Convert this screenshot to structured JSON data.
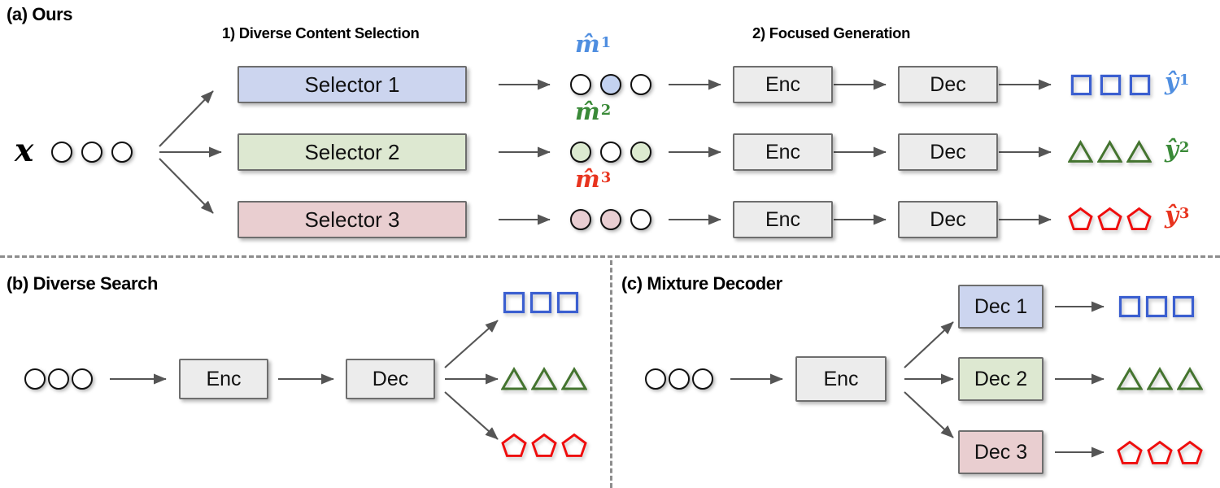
{
  "figure": {
    "panels": [
      {
        "id": "a",
        "title": "(a) Ours",
        "steps": [
          {
            "label": "1) Diverse Content Selection"
          },
          {
            "label": "2) Focused Generation"
          }
        ],
        "input_label": "x",
        "input_tokens": [
          "white",
          "white",
          "white"
        ],
        "rows": [
          {
            "selector_label": "Selector 1",
            "selector_color": "#ccd5ef",
            "mask_label_base": "m̂",
            "mask_label_sup": "1",
            "mask_color": "#4f8ee0",
            "mask_tokens": [
              "white",
              "blue",
              "white"
            ],
            "encoder_label": "Enc",
            "decoder_label": "Dec",
            "output_shape": "square",
            "output_color": "#3b5fd0",
            "output_count": 3,
            "output_label_base": "ŷ",
            "output_label_sup": "1"
          },
          {
            "selector_label": "Selector 2",
            "selector_color": "#dde8d1",
            "mask_label_base": "m̂",
            "mask_label_sup": "2",
            "mask_color": "#3a8a38",
            "mask_tokens": [
              "green",
              "white",
              "green"
            ],
            "encoder_label": "Enc",
            "decoder_label": "Dec",
            "output_shape": "triangle",
            "output_color": "#44742f",
            "output_count": 3,
            "output_label_base": "ŷ",
            "output_label_sup": "2"
          },
          {
            "selector_label": "Selector 3",
            "selector_color": "#e9ced0",
            "mask_label_base": "m̂",
            "mask_label_sup": "3",
            "mask_color": "#e8341f",
            "mask_tokens": [
              "pink",
              "pink",
              "white"
            ],
            "encoder_label": "Enc",
            "decoder_label": "Dec",
            "output_shape": "pentagon",
            "output_color": "#ef0d0d",
            "output_count": 3,
            "output_label_base": "ŷ",
            "output_label_sup": "3"
          }
        ]
      },
      {
        "id": "b",
        "title": "(b) Diverse Search",
        "input_tokens": [
          "white",
          "white",
          "white"
        ],
        "encoder_label": "Enc",
        "decoder_label": "Dec",
        "outputs": [
          {
            "shape": "square",
            "color": "#3b5fd0",
            "count": 3
          },
          {
            "shape": "triangle",
            "color": "#44742f",
            "count": 3
          },
          {
            "shape": "pentagon",
            "color": "#ef0d0d",
            "count": 3
          }
        ]
      },
      {
        "id": "c",
        "title": "(c) Mixture Decoder",
        "input_tokens": [
          "white",
          "white",
          "white"
        ],
        "encoder_label": "Enc",
        "decoders": [
          {
            "label": "Dec 1",
            "color": "#ccd5ef",
            "shape": "square",
            "shape_color": "#3b5fd0",
            "count": 3
          },
          {
            "label": "Dec 2",
            "color": "#dde8d1",
            "shape": "triangle",
            "shape_color": "#44742f",
            "count": 3
          },
          {
            "label": "Dec 3",
            "color": "#e9ced0",
            "shape": "pentagon",
            "shape_color": "#ef0d0d",
            "count": 3
          }
        ]
      }
    ],
    "colors": {
      "blue_fill": "#ccd5ef",
      "green_fill": "#dde8d1",
      "pink_fill": "#e9ced0",
      "gray_fill": "#ececec",
      "box_border": "#6e6e6e",
      "arrow": "#555555",
      "divider": "#8d8d8d"
    }
  }
}
